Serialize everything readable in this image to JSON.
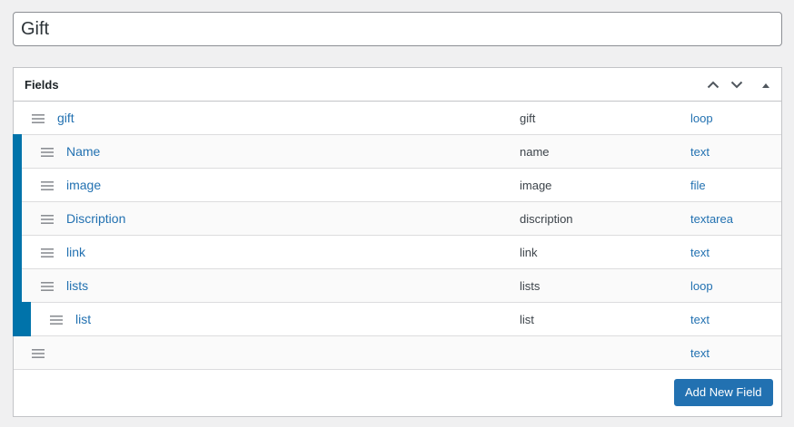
{
  "title": {
    "value": "Gift"
  },
  "postbox": {
    "heading": "Fields",
    "move_up_icon": "chevron-up-icon",
    "move_down_icon": "chevron-down-icon",
    "toggle_icon": "triangle-up-icon"
  },
  "fields": [
    {
      "label": "gift",
      "name": "gift",
      "type": "loop",
      "depth": 0
    },
    {
      "label": "Name",
      "name": "name",
      "type": "text",
      "depth": 1
    },
    {
      "label": "image",
      "name": "image",
      "type": "file",
      "depth": 1
    },
    {
      "label": "Discription",
      "name": "discription",
      "type": "textarea",
      "depth": 1
    },
    {
      "label": "link",
      "name": "link",
      "type": "text",
      "depth": 1
    },
    {
      "label": "lists",
      "name": "lists",
      "type": "loop",
      "depth": 1
    },
    {
      "label": "list",
      "name": "list",
      "type": "text",
      "depth": 2
    },
    {
      "label": "",
      "name": "",
      "type": "text",
      "depth": 0
    }
  ],
  "footer": {
    "add_button": "Add New Field"
  },
  "colors": {
    "accent": "#2271b1",
    "nest_bar": "#0073aa"
  }
}
